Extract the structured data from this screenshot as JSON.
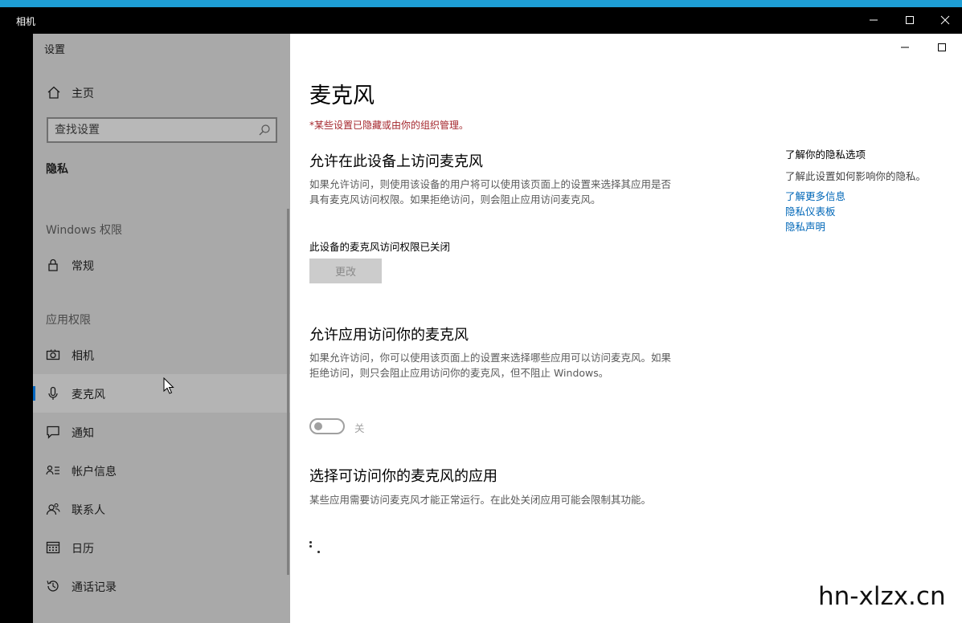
{
  "camera_window": {
    "title": "相机",
    "controls": [
      "minimize-icon",
      "maximize-icon",
      "close-icon"
    ]
  },
  "settings_window": {
    "controls": [
      "minimize-icon",
      "maximize-icon"
    ]
  },
  "sidebar": {
    "title": "设置",
    "home": {
      "label": "主页",
      "icon": "home-icon"
    },
    "search": {
      "placeholder": "查找设置",
      "icon": "search-icon"
    },
    "section": "隐私",
    "groups": [
      {
        "label": "Windows 权限"
      },
      {
        "label": "应用权限"
      }
    ],
    "items": [
      {
        "label": "常规",
        "icon": "lock-icon"
      },
      {
        "label": "相机",
        "icon": "camera-icon"
      },
      {
        "label": "麦克风",
        "icon": "microphone-icon",
        "selected": true
      },
      {
        "label": "通知",
        "icon": "notification-icon"
      },
      {
        "label": "帐户信息",
        "icon": "account-info-icon"
      },
      {
        "label": "联系人",
        "icon": "contacts-icon"
      },
      {
        "label": "日历",
        "icon": "calendar-icon"
      },
      {
        "label": "通话记录",
        "icon": "call-history-icon"
      }
    ]
  },
  "main": {
    "title": "麦克风",
    "org_note": "*某些设置已隐藏或由你的组织管理。",
    "sections": [
      {
        "heading": "允许在此设备上访问麦克风",
        "description": "如果允许访问，则使用该设备的用户将可以使用该页面上的设置来选择其应用是否具有麦克风访问权限。如果拒绝访问，则会阻止应用访问麦克风。",
        "status": "此设备的麦克风访问权限已关闭",
        "button": "更改"
      },
      {
        "heading": "允许应用访问你的麦克风",
        "description": "如果允许访问，你可以使用该页面上的设置来选择哪些应用可以访问麦克风。如果拒绝访问，则只会阻止应用访问你的麦克风，但不阻止 Windows。",
        "toggle_label": "关",
        "toggle_on": false
      },
      {
        "heading": "选择可访问你的麦克风的应用",
        "description": "某些应用需要访问麦克风才能正常运行。在此处关闭应用可能会限制其功能。"
      }
    ],
    "aside": {
      "title": "了解你的隐私选项",
      "description": "了解此设置如何影响你的隐私。",
      "links": [
        "了解更多信息",
        "隐私仪表板",
        "隐私声明"
      ]
    }
  },
  "watermark": "hn-xlzx.cn",
  "colors": {
    "accent": "#0067c0",
    "link": "#0067b8",
    "warning": "#a4262c",
    "sidebar_bg": "#a9a9a9",
    "taskbar_strip": "#1e9fd6"
  }
}
